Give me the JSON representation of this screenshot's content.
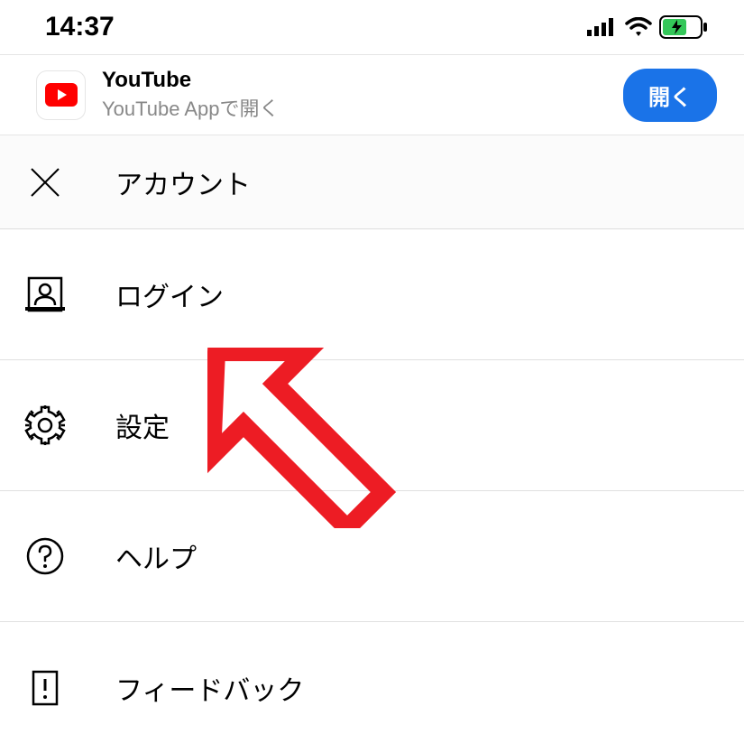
{
  "status": {
    "time": "14:37"
  },
  "appBanner": {
    "title": "YouTube",
    "subtitle": "YouTube Appで開く",
    "openButton": "開く"
  },
  "header": {
    "title": "アカウント"
  },
  "menu": {
    "login": "ログイン",
    "settings": "設定",
    "help": "ヘルプ",
    "feedback": "フィードバック"
  }
}
